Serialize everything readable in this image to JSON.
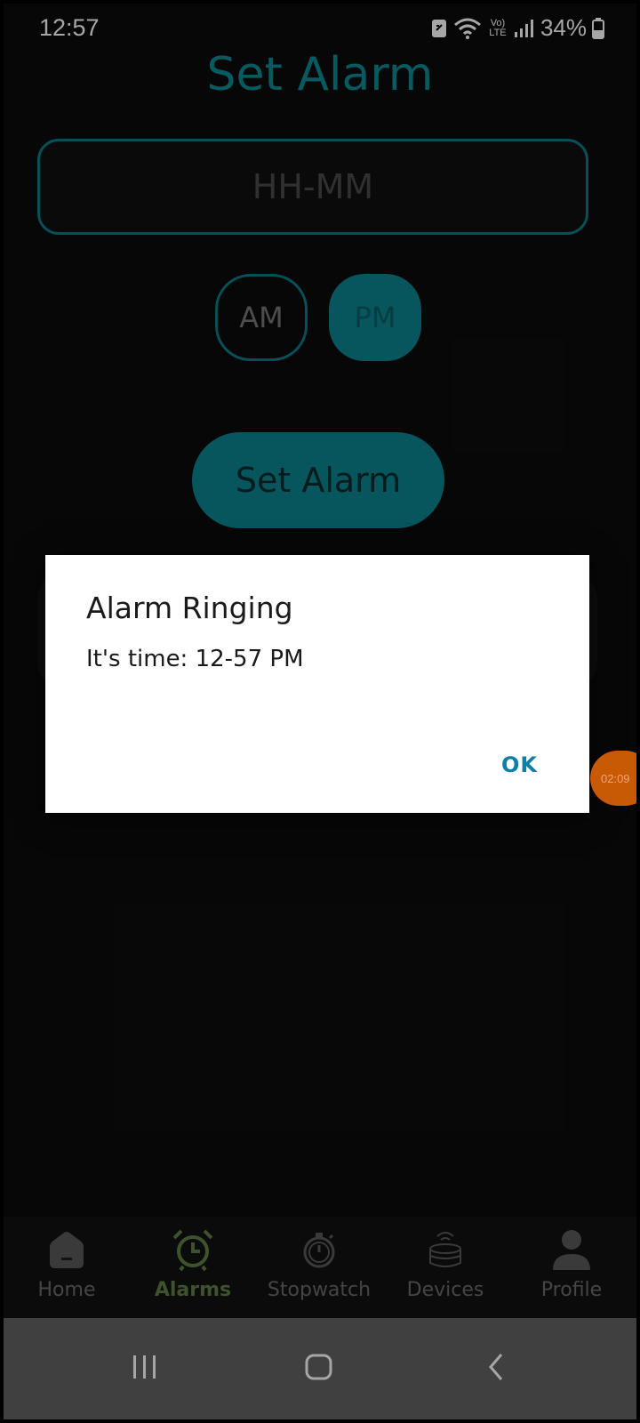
{
  "status_bar": {
    "time": "12:57",
    "battery": "34%",
    "volte_label": "Vo) LTE"
  },
  "screen": {
    "title": "Set Alarm",
    "time_input": {
      "placeholder": "HH-MM",
      "value": ""
    },
    "am_label": "AM",
    "pm_label": "PM",
    "selected_period": "PM",
    "set_button_label": "Set Alarm",
    "accent_color": "#0b8590"
  },
  "dialog": {
    "title": "Alarm Ringing",
    "message": "It's time: 12-57 PM",
    "ok_label": "OK"
  },
  "floating_bubble": {
    "text": "02:09"
  },
  "bottom_nav": {
    "items": [
      {
        "label": "Home",
        "icon": "home-icon",
        "active": false
      },
      {
        "label": "Alarms",
        "icon": "alarm-clock-icon",
        "active": true
      },
      {
        "label": "Stopwatch",
        "icon": "stopwatch-icon",
        "active": false
      },
      {
        "label": "Devices",
        "icon": "smart-speaker-icon",
        "active": false
      },
      {
        "label": "Profile",
        "icon": "person-icon",
        "active": false
      }
    ]
  },
  "system_nav": {
    "buttons": [
      "recents-icon",
      "home-icon",
      "back-icon"
    ]
  }
}
